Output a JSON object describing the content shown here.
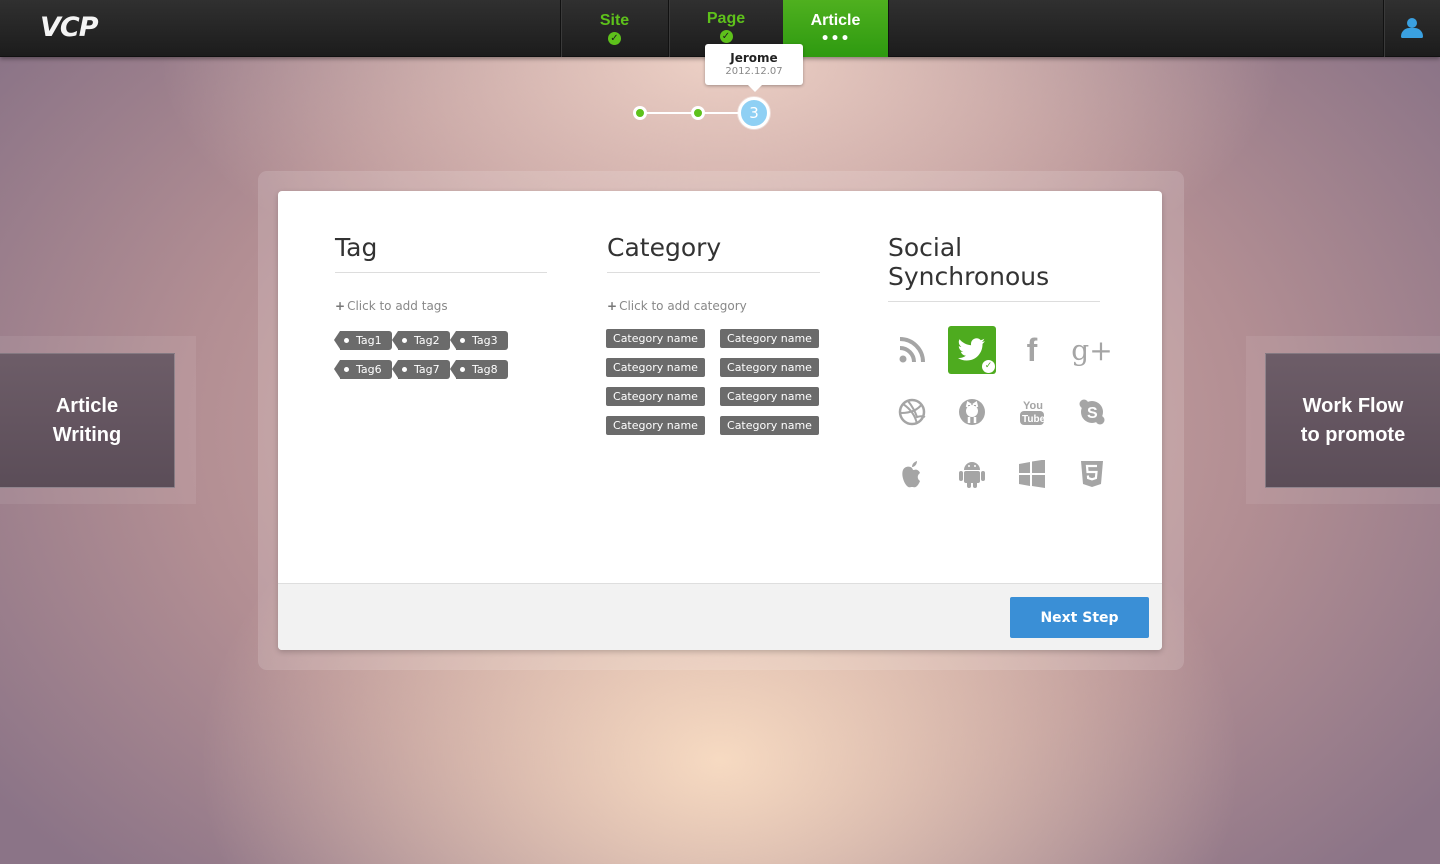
{
  "app": {
    "logo": "VCP"
  },
  "nav": {
    "site": {
      "label": "Site",
      "check": "✓"
    },
    "page": {
      "label": "Page",
      "check": "✓"
    },
    "article": {
      "label": "Article",
      "dots": "•••"
    }
  },
  "tooltip": {
    "name": "Jerome",
    "date": "2012.12.07"
  },
  "progress": {
    "current_step": "3"
  },
  "side": {
    "left": [
      "Article",
      "Writing"
    ],
    "right": [
      "Work Flow",
      "to promote"
    ]
  },
  "tags": {
    "title": "Tag",
    "add_label": "Click to add tags",
    "items": [
      "Tag1",
      "Tag2",
      "Tag3",
      "Tag6",
      "Tag7",
      "Tag8"
    ]
  },
  "category": {
    "title": "Category",
    "add_label": "Click to add category",
    "items": [
      "Category name",
      "Category name",
      "Category name",
      "Category name",
      "Category name",
      "Category name",
      "Category name",
      "Category name"
    ]
  },
  "social": {
    "title": "Social Synchronous",
    "icons": [
      "rss-icon",
      "twitter-icon",
      "facebook-icon",
      "google-plus-icon",
      "dribbble-icon",
      "github-icon",
      "youtube-icon",
      "skype-icon",
      "apple-icon",
      "android-icon",
      "windows-icon",
      "html5-icon"
    ],
    "active_icon": "twitter-icon",
    "active_color": "#4eab1f"
  },
  "footer": {
    "next_label": "Next Step",
    "button_color": "#3a8fd6"
  },
  "colors": {
    "accent_green": "#5ec11b",
    "tag_bg": "#6b6b6b"
  }
}
